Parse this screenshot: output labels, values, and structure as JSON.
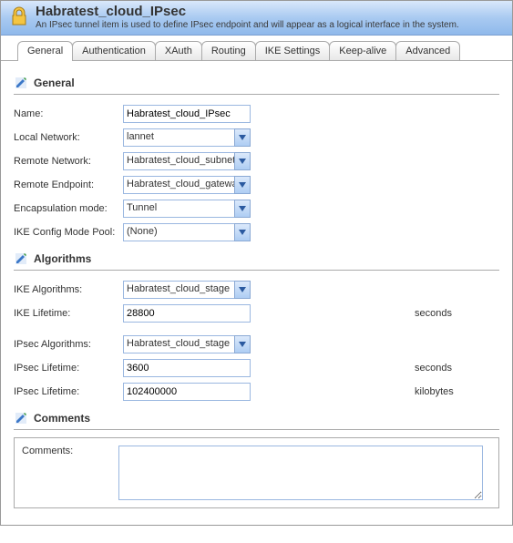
{
  "header": {
    "title": "Habratest_cloud_IPsec",
    "subtitle": "An IPsec tunnel item is used to define IPsec endpoint and will appear as a logical interface in the system."
  },
  "tabs": [
    "General",
    "Authentication",
    "XAuth",
    "Routing",
    "IKE Settings",
    "Keep-alive",
    "Advanced"
  ],
  "active_tab": 0,
  "sections": {
    "general": {
      "title": "General",
      "fields": {
        "name": {
          "label": "Name:",
          "value": "Habratest_cloud_IPsec"
        },
        "local_network": {
          "label": "Local Network:",
          "value": "lannet"
        },
        "remote_network": {
          "label": "Remote Network:",
          "value": "Habratest_cloud_subnet"
        },
        "remote_endpoint": {
          "label": "Remote Endpoint:",
          "value": "Habratest_cloud_gateway"
        },
        "encapsulation_mode": {
          "label": "Encapsulation mode:",
          "value": "Tunnel"
        },
        "ike_config_mode_pool": {
          "label": "IKE Config Mode Pool:",
          "value": "(None)"
        }
      }
    },
    "algorithms": {
      "title": "Algorithms",
      "fields": {
        "ike_algorithms": {
          "label": "IKE Algorithms:",
          "value": "Habratest_cloud_stage"
        },
        "ike_lifetime": {
          "label": "IKE Lifetime:",
          "value": "28800",
          "unit": "seconds"
        },
        "ipsec_algorithms": {
          "label": "IPsec Algorithms:",
          "value": "Habratest_cloud_stage"
        },
        "ipsec_lifetime_sec": {
          "label": "IPsec Lifetime:",
          "value": "3600",
          "unit": "seconds"
        },
        "ipsec_lifetime_kb": {
          "label": "IPsec Lifetime:",
          "value": "102400000",
          "unit": "kilobytes"
        }
      }
    },
    "comments": {
      "title": "Comments",
      "fields": {
        "comments": {
          "label": "Comments:",
          "value": ""
        }
      }
    }
  }
}
